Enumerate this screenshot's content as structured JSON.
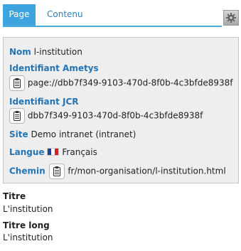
{
  "tabs": [
    {
      "label": "Page",
      "active": true
    },
    {
      "label": "Contenu",
      "active": false
    }
  ],
  "toolbar": {
    "settings_icon": "gear-icon"
  },
  "properties": {
    "nom": {
      "label": "Nom",
      "value": "l-institution"
    },
    "identifiant_ametys": {
      "label": "Identifiant Ametys",
      "value": "page://dbb7f349-9103-470d-8f0b-4c3bfde8938f"
    },
    "identifiant_jcr": {
      "label": "Identifiant JCR",
      "value": "dbb7f349-9103-470d-8f0b-4c3bfde8938f"
    },
    "site": {
      "label": "Site",
      "value": "Demo intranet (intranet)"
    },
    "langue": {
      "label": "Langue",
      "value": "Français",
      "flag": "france-flag-icon"
    },
    "chemin": {
      "label": "Chemin",
      "value": "fr/mon-organisation/l-institution.html"
    }
  },
  "fields": {
    "titre": {
      "label": "Titre",
      "value": "L'institution"
    },
    "titre_long": {
      "label": "Titre long",
      "value": "L'institution"
    }
  },
  "colors": {
    "accent": "#3ea4e0",
    "label": "#2474b3",
    "panel_bg": "#eeeeee"
  }
}
